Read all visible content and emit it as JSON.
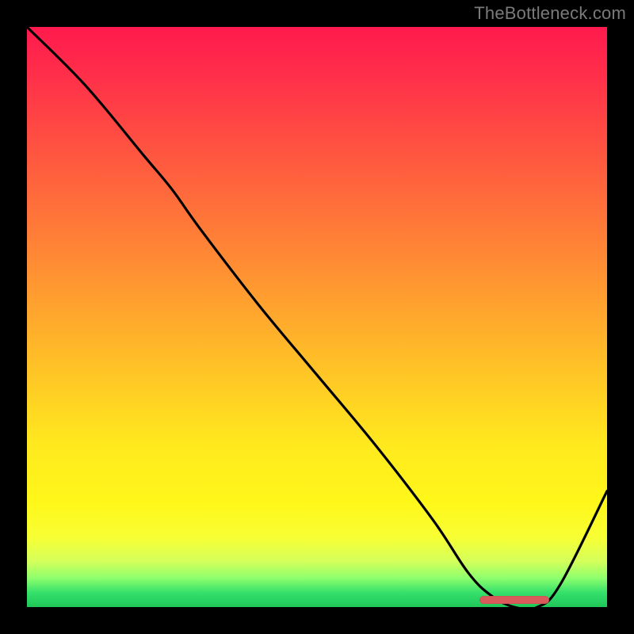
{
  "watermark": "TheBottleneck.com",
  "colors": {
    "gradient_top": "#ff1a4d",
    "gradient_mid_orange": "#ff8a34",
    "gradient_mid_yellow": "#ffe91e",
    "gradient_bottom": "#1fc75a",
    "curve": "#000000",
    "marker": "#d85a5a"
  },
  "chart_data": {
    "type": "line",
    "title": "",
    "xlabel": "",
    "ylabel": "",
    "xlim": [
      0,
      100
    ],
    "ylim": [
      0,
      100
    ],
    "series": [
      {
        "name": "bottleneck-curve",
        "x": [
          0,
          10,
          20,
          25,
          30,
          40,
          50,
          60,
          70,
          76,
          80,
          84,
          88,
          92,
          100
        ],
        "y": [
          100,
          90,
          78,
          72,
          65,
          52,
          40,
          28,
          15,
          6,
          2,
          0,
          0,
          4,
          20
        ]
      }
    ],
    "annotations": [
      {
        "name": "optimal-range-marker",
        "x_start": 78,
        "x_end": 90,
        "y": 1.2
      }
    ]
  }
}
